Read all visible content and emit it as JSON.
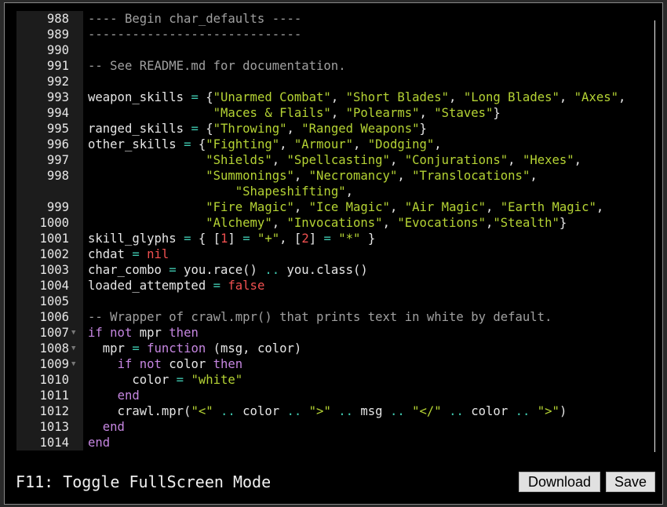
{
  "editor": {
    "lines": [
      {
        "num": "988",
        "fold": false,
        "segs": [
          [
            "comment",
            "---- Begin char_defaults ----"
          ]
        ]
      },
      {
        "num": "989",
        "fold": false,
        "segs": [
          [
            "comment",
            "-----------------------------"
          ]
        ]
      },
      {
        "num": "990",
        "fold": false,
        "segs": []
      },
      {
        "num": "991",
        "fold": false,
        "segs": [
          [
            "comment",
            "-- See README.md for documentation."
          ]
        ]
      },
      {
        "num": "992",
        "fold": false,
        "segs": []
      },
      {
        "num": "993",
        "fold": false,
        "segs": [
          [
            "plain",
            "weapon_skills "
          ],
          [
            "op",
            "="
          ],
          [
            "plain",
            " {"
          ],
          [
            "string",
            "\"Unarmed Combat\""
          ],
          [
            "plain",
            ", "
          ],
          [
            "string",
            "\"Short Blades\""
          ],
          [
            "plain",
            ", "
          ],
          [
            "string",
            "\"Long Blades\""
          ],
          [
            "plain",
            ", "
          ],
          [
            "string",
            "\"Axes\""
          ],
          [
            "plain",
            ","
          ]
        ]
      },
      {
        "num": "994",
        "fold": false,
        "segs": [
          [
            "plain",
            "                 "
          ],
          [
            "string",
            "\"Maces & Flails\""
          ],
          [
            "plain",
            ", "
          ],
          [
            "string",
            "\"Polearms\""
          ],
          [
            "plain",
            ", "
          ],
          [
            "string",
            "\"Staves\""
          ],
          [
            "plain",
            "}"
          ]
        ]
      },
      {
        "num": "995",
        "fold": false,
        "segs": [
          [
            "plain",
            "ranged_skills "
          ],
          [
            "op",
            "="
          ],
          [
            "plain",
            " {"
          ],
          [
            "string",
            "\"Throwing\""
          ],
          [
            "plain",
            ", "
          ],
          [
            "string",
            "\"Ranged Weapons\""
          ],
          [
            "plain",
            "}"
          ]
        ]
      },
      {
        "num": "996",
        "fold": false,
        "segs": [
          [
            "plain",
            "other_skills "
          ],
          [
            "op",
            "="
          ],
          [
            "plain",
            " {"
          ],
          [
            "string",
            "\"Fighting\""
          ],
          [
            "plain",
            ", "
          ],
          [
            "string",
            "\"Armour\""
          ],
          [
            "plain",
            ", "
          ],
          [
            "string",
            "\"Dodging\""
          ],
          [
            "plain",
            ","
          ]
        ]
      },
      {
        "num": "997",
        "fold": false,
        "segs": [
          [
            "plain",
            "                "
          ],
          [
            "string",
            "\"Shields\""
          ],
          [
            "plain",
            ", "
          ],
          [
            "string",
            "\"Spellcasting\""
          ],
          [
            "plain",
            ", "
          ],
          [
            "string",
            "\"Conjurations\""
          ],
          [
            "plain",
            ", "
          ],
          [
            "string",
            "\"Hexes\""
          ],
          [
            "plain",
            ","
          ]
        ]
      },
      {
        "num": "998",
        "fold": false,
        "segs": [
          [
            "plain",
            "                "
          ],
          [
            "string",
            "\"Summonings\""
          ],
          [
            "plain",
            ", "
          ],
          [
            "string",
            "\"Necromancy\""
          ],
          [
            "plain",
            ", "
          ],
          [
            "string",
            "\"Translocations\""
          ],
          [
            "plain",
            ","
          ]
        ]
      },
      {
        "num": "",
        "fold": false,
        "segs": [
          [
            "plain",
            "                    "
          ],
          [
            "string",
            "\"Shapeshifting\""
          ],
          [
            "plain",
            ","
          ]
        ]
      },
      {
        "num": "999",
        "fold": false,
        "segs": [
          [
            "plain",
            "                "
          ],
          [
            "string",
            "\"Fire Magic\""
          ],
          [
            "plain",
            ", "
          ],
          [
            "string",
            "\"Ice Magic\""
          ],
          [
            "plain",
            ", "
          ],
          [
            "string",
            "\"Air Magic\""
          ],
          [
            "plain",
            ", "
          ],
          [
            "string",
            "\"Earth Magic\""
          ],
          [
            "plain",
            ","
          ]
        ]
      },
      {
        "num": "1000",
        "fold": false,
        "segs": [
          [
            "plain",
            "                "
          ],
          [
            "string",
            "\"Alchemy\""
          ],
          [
            "plain",
            ", "
          ],
          [
            "string",
            "\"Invocations\""
          ],
          [
            "plain",
            ", "
          ],
          [
            "string",
            "\"Evocations\""
          ],
          [
            "plain",
            ","
          ],
          [
            "string",
            "\"Stealth\""
          ],
          [
            "plain",
            "}"
          ]
        ]
      },
      {
        "num": "1001",
        "fold": false,
        "segs": [
          [
            "plain",
            "skill_glyphs "
          ],
          [
            "op",
            "="
          ],
          [
            "plain",
            " { ["
          ],
          [
            "number",
            "1"
          ],
          [
            "plain",
            "] "
          ],
          [
            "op",
            "="
          ],
          [
            "plain",
            " "
          ],
          [
            "string",
            "\"+\""
          ],
          [
            "plain",
            ", ["
          ],
          [
            "number",
            "2"
          ],
          [
            "plain",
            "] "
          ],
          [
            "op",
            "="
          ],
          [
            "plain",
            " "
          ],
          [
            "string",
            "\"*\""
          ],
          [
            "plain",
            " }"
          ]
        ]
      },
      {
        "num": "1002",
        "fold": false,
        "segs": [
          [
            "plain",
            "chdat "
          ],
          [
            "op",
            "="
          ],
          [
            "plain",
            " "
          ],
          [
            "number",
            "nil"
          ]
        ]
      },
      {
        "num": "1003",
        "fold": false,
        "segs": [
          [
            "plain",
            "char_combo "
          ],
          [
            "op",
            "="
          ],
          [
            "plain",
            " you.race() "
          ],
          [
            "op",
            ".."
          ],
          [
            "plain",
            " you.class()"
          ]
        ]
      },
      {
        "num": "1004",
        "fold": false,
        "segs": [
          [
            "plain",
            "loaded_attempted "
          ],
          [
            "op",
            "="
          ],
          [
            "plain",
            " "
          ],
          [
            "number",
            "false"
          ]
        ]
      },
      {
        "num": "1005",
        "fold": false,
        "segs": []
      },
      {
        "num": "1006",
        "fold": false,
        "segs": [
          [
            "comment",
            "-- Wrapper of crawl.mpr() that prints text in white by default."
          ]
        ]
      },
      {
        "num": "1007",
        "fold": true,
        "segs": [
          [
            "keyword",
            "if"
          ],
          [
            "plain",
            " "
          ],
          [
            "keyword",
            "not"
          ],
          [
            "plain",
            " mpr "
          ],
          [
            "keyword",
            "then"
          ]
        ]
      },
      {
        "num": "1008",
        "fold": true,
        "segs": [
          [
            "plain",
            "  mpr "
          ],
          [
            "op",
            "="
          ],
          [
            "plain",
            " "
          ],
          [
            "keyword",
            "function"
          ],
          [
            "plain",
            " (msg, color)"
          ]
        ]
      },
      {
        "num": "1009",
        "fold": true,
        "segs": [
          [
            "plain",
            "    "
          ],
          [
            "keyword",
            "if"
          ],
          [
            "plain",
            " "
          ],
          [
            "keyword",
            "not"
          ],
          [
            "plain",
            " color "
          ],
          [
            "keyword",
            "then"
          ]
        ]
      },
      {
        "num": "1010",
        "fold": false,
        "segs": [
          [
            "plain",
            "      color "
          ],
          [
            "op",
            "="
          ],
          [
            "plain",
            " "
          ],
          [
            "string",
            "\"white\""
          ]
        ]
      },
      {
        "num": "1011",
        "fold": false,
        "segs": [
          [
            "plain",
            "    "
          ],
          [
            "keyword",
            "end"
          ]
        ]
      },
      {
        "num": "1012",
        "fold": false,
        "segs": [
          [
            "plain",
            "    crawl.mpr("
          ],
          [
            "string",
            "\"<\""
          ],
          [
            "plain",
            " "
          ],
          [
            "op",
            ".."
          ],
          [
            "plain",
            " color "
          ],
          [
            "op",
            ".."
          ],
          [
            "plain",
            " "
          ],
          [
            "string",
            "\">\""
          ],
          [
            "plain",
            " "
          ],
          [
            "op",
            ".."
          ],
          [
            "plain",
            " msg "
          ],
          [
            "op",
            ".."
          ],
          [
            "plain",
            " "
          ],
          [
            "string",
            "\"</\""
          ],
          [
            "plain",
            " "
          ],
          [
            "op",
            ".."
          ],
          [
            "plain",
            " color "
          ],
          [
            "op",
            ".."
          ],
          [
            "plain",
            " "
          ],
          [
            "string",
            "\">\""
          ],
          [
            "plain",
            ")"
          ]
        ]
      },
      {
        "num": "1013",
        "fold": false,
        "segs": [
          [
            "plain",
            "  "
          ],
          [
            "keyword",
            "end"
          ]
        ]
      },
      {
        "num": "1014",
        "fold": false,
        "segs": [
          [
            "keyword",
            "end"
          ]
        ]
      }
    ]
  },
  "footer": {
    "hint": "F11: Toggle FullScreen Mode",
    "download_label": "Download",
    "save_label": "Save"
  },
  "icons": {
    "scroll_up": "triangle-up",
    "scroll_down": "triangle-down",
    "fold": "triangle-down"
  },
  "colors": {
    "comment": "#a0a0a0",
    "string": "#b5d334",
    "keyword": "#c586e0",
    "operator": "#3fc9b0",
    "number": "#f05050"
  }
}
